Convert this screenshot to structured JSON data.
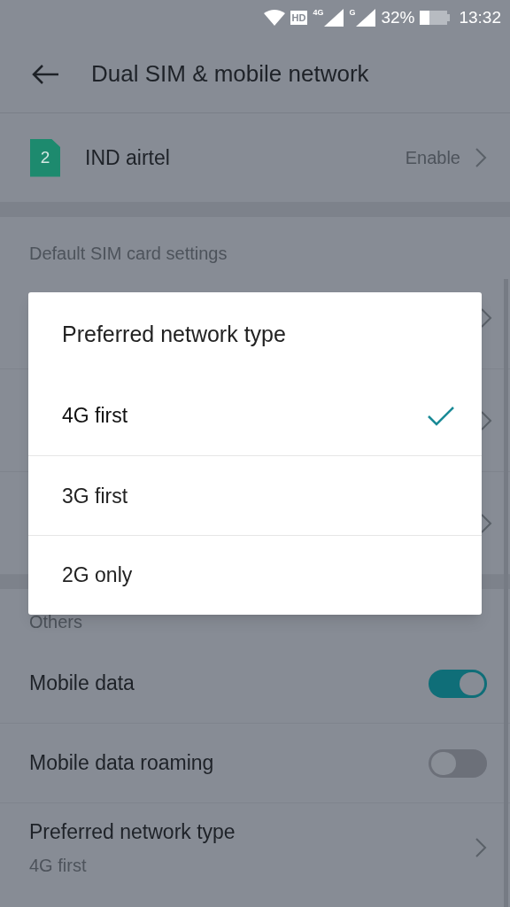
{
  "status_bar": {
    "badges": [
      "HD"
    ],
    "signals": [
      {
        "label": "4G"
      },
      {
        "label": "G"
      }
    ],
    "battery": "32%",
    "time": "13:32"
  },
  "header": {
    "title": "Dual SIM & mobile network"
  },
  "sim": {
    "slot": "2",
    "name": "IND airtel",
    "action": "Enable"
  },
  "default_sim": {
    "title": "Default SIM card settings"
  },
  "others": {
    "title": "Others",
    "items": [
      {
        "kind": "toggle",
        "label": "Mobile data",
        "on": true
      },
      {
        "kind": "toggle",
        "label": "Mobile data roaming",
        "on": false
      },
      {
        "kind": "link",
        "label": "Preferred network type",
        "value": "4G first"
      }
    ]
  },
  "dialog": {
    "title": "Preferred network type",
    "options": [
      {
        "label": "4G first",
        "selected": true
      },
      {
        "label": "3G first",
        "selected": false
      },
      {
        "label": "2G only",
        "selected": false
      }
    ]
  }
}
